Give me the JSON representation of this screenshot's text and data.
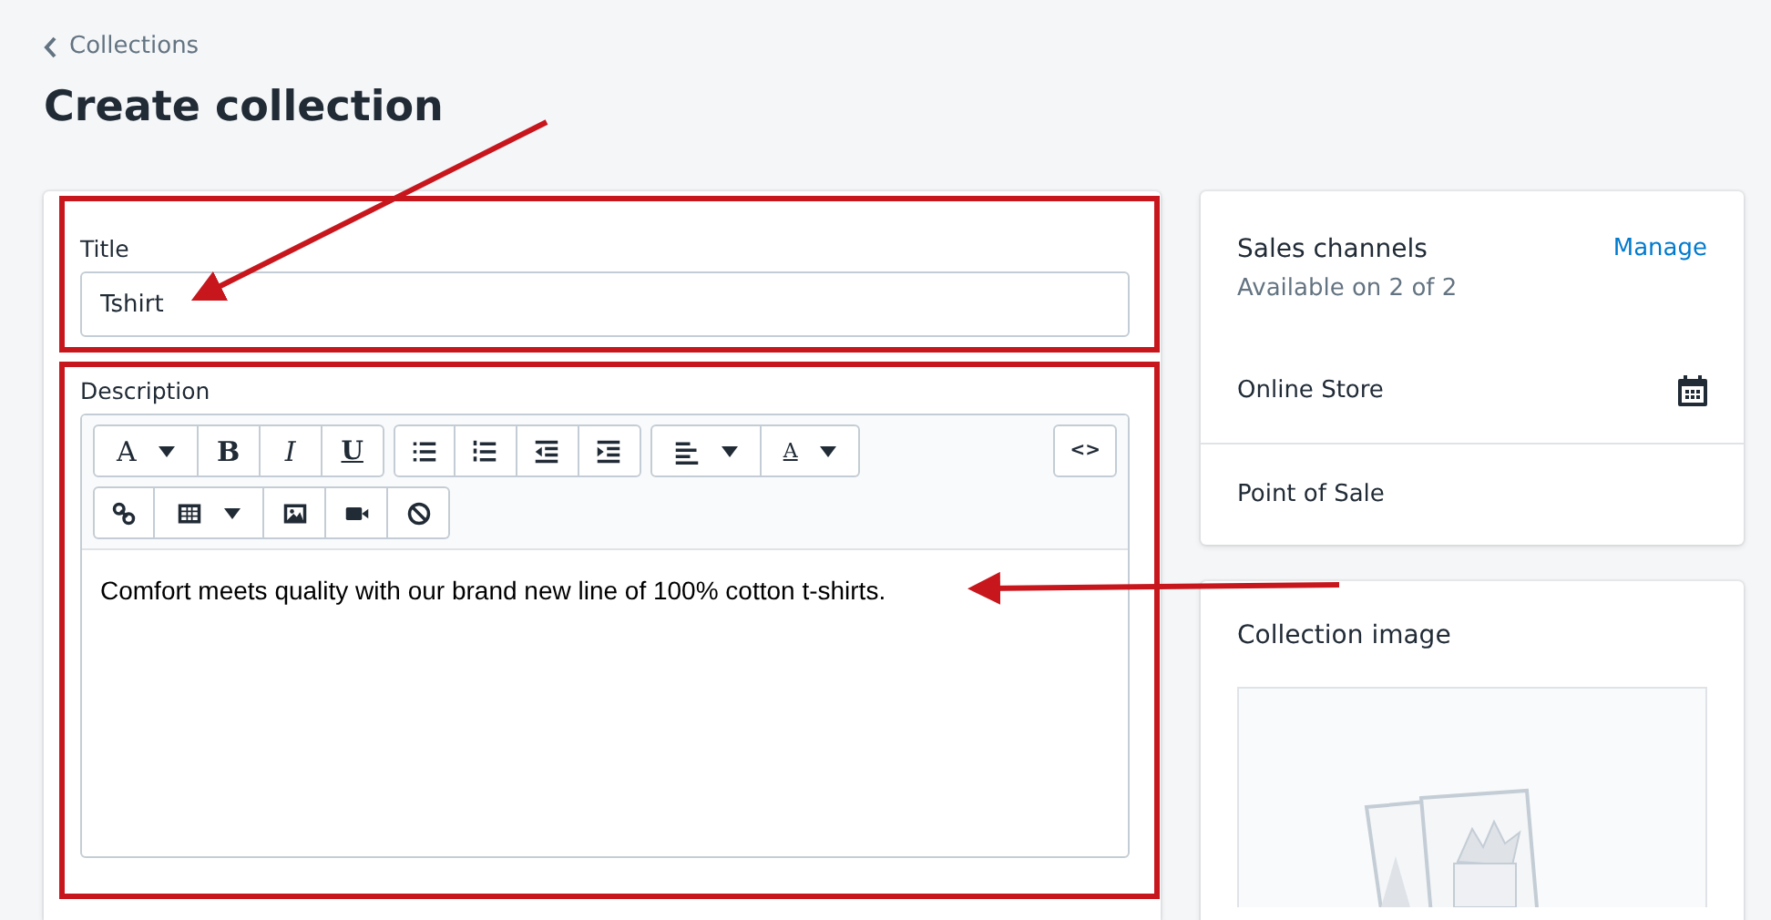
{
  "breadcrumb": {
    "label": "Collections"
  },
  "heading": "Create collection",
  "title_field": {
    "label": "Title",
    "value": "Tshirt"
  },
  "description": {
    "label": "Description",
    "toolbar_glyphs": [
      "A",
      "B",
      "I",
      "U",
      "A",
      "<>"
    ],
    "body": "Comfort meets quality with our brand new line of 100% cotton t-shirts."
  },
  "sales_channels": {
    "title": "Sales channels",
    "subtitle": "Available on 2 of 2",
    "action": "Manage",
    "channels": [
      {
        "name": "Online Store",
        "scheduled": true
      },
      {
        "name": "Point of Sale",
        "scheduled": false
      }
    ]
  },
  "collection_image": {
    "title": "Collection image"
  }
}
